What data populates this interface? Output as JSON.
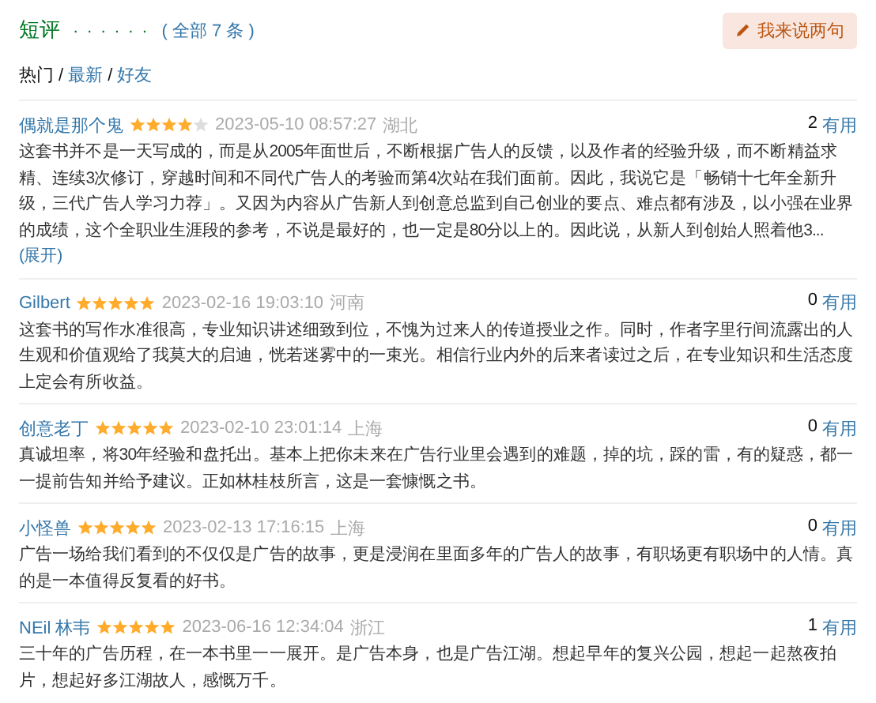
{
  "header": {
    "title": "短评",
    "dots": "· · · · · ·",
    "count_link": "( 全部 7 条 )",
    "write_button": "我来说两句"
  },
  "tab_separator": "/",
  "sort_tabs": [
    {
      "label": "热门",
      "selected": true
    },
    {
      "label": "最新",
      "selected": false
    },
    {
      "label": "好友",
      "selected": false
    }
  ],
  "reviews": [
    {
      "user": "偶就是那个鬼",
      "stars": 4,
      "time": "2023-05-10 08:57:27",
      "location": "湖北",
      "useful_count": "2",
      "useful_label": "有用",
      "text": "这套书并不是一天写成的，而是从2005年面世后，不断根据广告人的反馈，以及作者的经验升级，而不断精益求精、连续3次修订，穿越时间和不同代广告人的考验而第4次站在我们面前。因此，我说它是「畅销十七年全新升级，三代广告人学习力荐」。又因为内容从广告新人到创意总监到自己创业的要点、难点都有涉及，以小强在业界的成绩，这个全职业生涯段的参考，不说是最好的，也一定是80分以上的。因此说，从新人到创始人照着他3...",
      "expand": "(展开)"
    },
    {
      "user": "Gilbert",
      "stars": 5,
      "time": "2023-02-16 19:03:10",
      "location": "河南",
      "useful_count": "0",
      "useful_label": "有用",
      "text": "这套书的写作水准很高，专业知识讲述细致到位，不愧为过来人的传道授业之作。同时，作者字里行间流露出的人生观和价值观给了我莫大的启迪，恍若迷雾中的一束光。相信行业内外的后来者读过之后，在专业知识和生活态度上定会有所收益。"
    },
    {
      "user": "创意老丁",
      "stars": 5,
      "time": "2023-02-10 23:01:14",
      "location": "上海",
      "useful_count": "0",
      "useful_label": "有用",
      "text": "真诚坦率，将30年经验和盘托出。基本上把你未来在广告行业里会遇到的难题，掉的坑，踩的雷，有的疑惑，都一一提前告知并给予建议。正如林桂枝所言，这是一套慷慨之书。"
    },
    {
      "user": "小怪兽",
      "stars": 5,
      "time": "2023-02-13 17:16:15",
      "location": "上海",
      "useful_count": "0",
      "useful_label": "有用",
      "text": "广告一场给我们看到的不仅仅是广告的故事，更是浸润在里面多年的广告人的故事，有职场更有职场中的人情。真的是一本值得反复看的好书。"
    },
    {
      "user": "NEil 林韦",
      "stars": 5,
      "time": "2023-06-16 12:34:04",
      "location": "浙江",
      "useful_count": "1",
      "useful_label": "有用",
      "text": "三十年的广告历程，在一本书里一一展开。是广告本身，也是广告江湖。想起早年的复兴公园，想起一起熬夜拍片，想起好多江湖故人，感慨万千。"
    }
  ]
}
